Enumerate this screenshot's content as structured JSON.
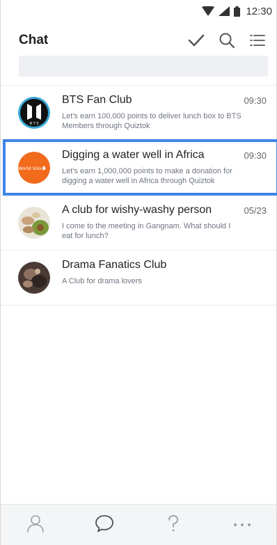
{
  "status_bar": {
    "time": "12:30"
  },
  "header": {
    "title": "Chat"
  },
  "search": {
    "placeholder": ""
  },
  "chats": [
    {
      "name": "BTS Fan Club",
      "time": "09:30",
      "preview": "Let's earn 100,000 points to deliver lunch box to BTS Members through Quiztok"
    },
    {
      "name": "Digging a water well in Africa",
      "time": "09:30",
      "preview": "Let's earn 1,000,000 points to make a donation for digging a water well in Africa through Quiztok",
      "avatar_text": "World Vision"
    },
    {
      "name": "A club for wishy-washy person",
      "time": "05/23",
      "preview": "I come to the meeting in Gangnam. What should I eat for lunch?"
    },
    {
      "name": "Drama Fanatics Club",
      "time": "",
      "preview": "A Club for drama lovers"
    }
  ],
  "colors": {
    "accent": "#3d85e6",
    "world_vision": "#f26b1d",
    "bts_ring": "#3aa9d8"
  },
  "icons": [
    "wifi-icon",
    "signal-icon",
    "battery-icon",
    "check-icon",
    "search-icon",
    "list-menu-icon",
    "person-icon",
    "chat-bubble-icon",
    "question-icon",
    "more-icon"
  ]
}
